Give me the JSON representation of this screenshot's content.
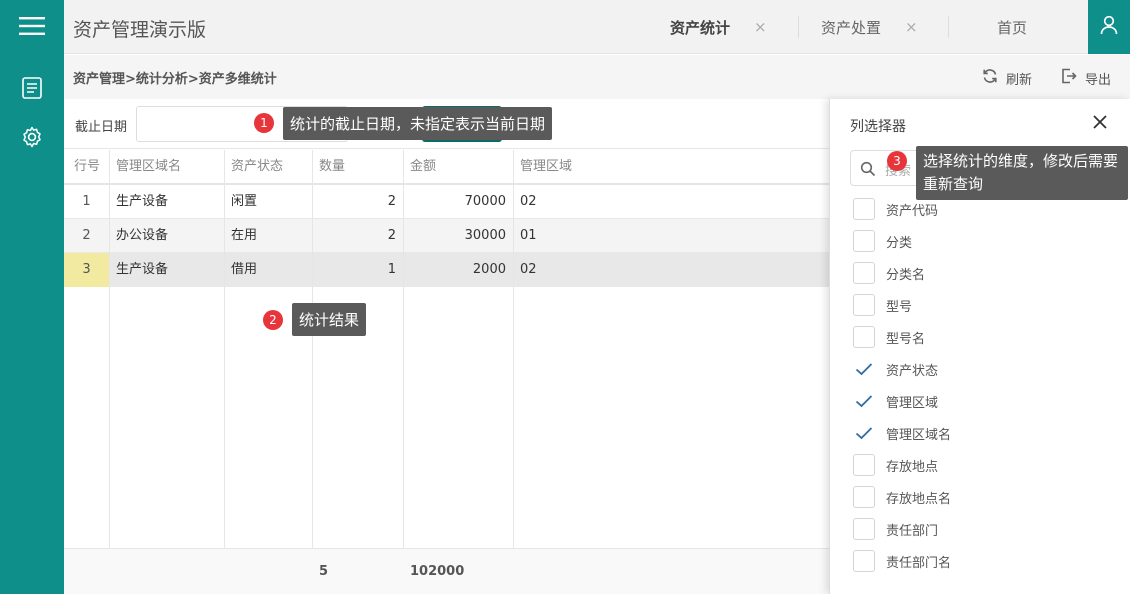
{
  "app": {
    "title": "资产管理演示版"
  },
  "tabs": [
    {
      "label": "资产统计",
      "close": "×",
      "active": true
    },
    {
      "label": "资产处置",
      "close": "×",
      "active": false
    },
    {
      "label": "首页",
      "active": false
    }
  ],
  "breadcrumb": "资产管理>统计分析>资产多维统计",
  "toolbar": {
    "refresh_label": "刷新",
    "export_label": "导出"
  },
  "filter": {
    "date_label": "截止日期",
    "date_value": ""
  },
  "grid": {
    "columns": [
      "行号",
      "管理区域名",
      "资产状态",
      "数量",
      "金额",
      "管理区域"
    ],
    "rows": [
      {
        "rn": "1",
        "area_name": "生产设备",
        "status": "闲置",
        "qty": "2",
        "amount": "70000",
        "area": "02"
      },
      {
        "rn": "2",
        "area_name": "办公设备",
        "status": "在用",
        "qty": "2",
        "amount": "30000",
        "area": "01"
      },
      {
        "rn": "3",
        "area_name": "生产设备",
        "status": "借用",
        "qty": "1",
        "amount": "2000",
        "area": "02"
      }
    ],
    "totals": {
      "qty": "5",
      "amount": "102000"
    }
  },
  "column_picker": {
    "title": "列选择器",
    "search_placeholder": "搜索",
    "options": [
      {
        "label": "资产代码",
        "checked": false
      },
      {
        "label": "分类",
        "checked": false
      },
      {
        "label": "分类名",
        "checked": false
      },
      {
        "label": "型号",
        "checked": false
      },
      {
        "label": "型号名",
        "checked": false
      },
      {
        "label": "资产状态",
        "checked": true
      },
      {
        "label": "管理区域",
        "checked": true
      },
      {
        "label": "管理区域名",
        "checked": true
      },
      {
        "label": "存放地点",
        "checked": false
      },
      {
        "label": "存放地点名",
        "checked": false
      },
      {
        "label": "责任部门",
        "checked": false
      },
      {
        "label": "责任部门名",
        "checked": false
      }
    ]
  },
  "tooltips": [
    {
      "badge": "1",
      "text": "统计的截止日期，未指定表示当前日期"
    },
    {
      "badge": "2",
      "text": "统计结果"
    },
    {
      "badge": "3",
      "text": "选择统计的维度，修改后需要重新查询"
    }
  ],
  "colors": {
    "accent": "#0e8f8a",
    "badge": "#e8343b",
    "tooltip_bg": "#5a5a5a"
  }
}
